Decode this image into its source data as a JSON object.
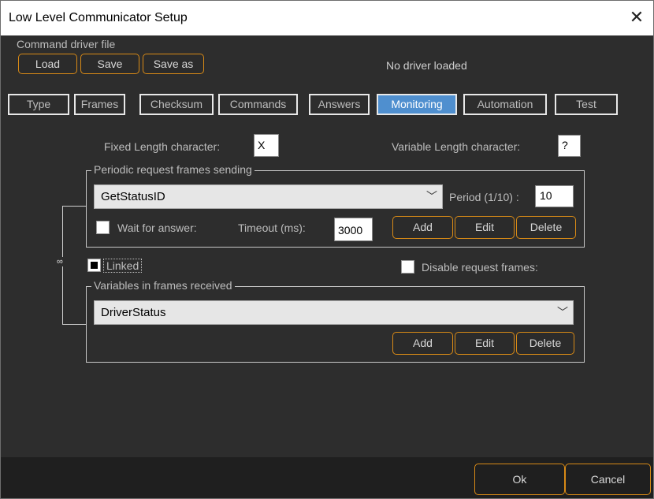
{
  "window": {
    "title": "Low Level Communicator Setup"
  },
  "driver": {
    "section_label": "Command driver file",
    "load_label": "Load",
    "save_label": "Save",
    "save_as_label": "Save as",
    "status": "No driver loaded"
  },
  "tabs": [
    {
      "label": "Type"
    },
    {
      "label": "Frames"
    },
    {
      "label": "Checksum"
    },
    {
      "label": "Commands"
    },
    {
      "label": "Answers"
    },
    {
      "label": "Monitoring",
      "active": true
    },
    {
      "label": "Automation"
    },
    {
      "label": "Test"
    }
  ],
  "monitoring": {
    "fixed_length_label": "Fixed Length character:",
    "fixed_length_value": "X",
    "variable_length_label": "Variable Length character:",
    "variable_length_value": "?",
    "periodic": {
      "group_title": "Periodic request frames sending",
      "frame_selected": "GetStatusID",
      "period_label": "Period (1/10) :",
      "period_value": "10",
      "wait_label": "Wait for answer:",
      "timeout_label": "Timeout (ms):",
      "timeout_value": "3000",
      "add_label": "Add",
      "edit_label": "Edit",
      "delete_label": "Delete"
    },
    "linked_label": "Linked",
    "disable_label": "Disable request frames:",
    "variables": {
      "group_title": "Variables in frames received",
      "selected": "DriverStatus",
      "add_label": "Add",
      "edit_label": "Edit",
      "delete_label": "Delete"
    }
  },
  "footer": {
    "ok_label": "Ok",
    "cancel_label": "Cancel"
  },
  "colors": {
    "accent_orange": "#d88a16",
    "active_tab": "#4f8fcf",
    "panel_bg": "#2d2d2d"
  }
}
